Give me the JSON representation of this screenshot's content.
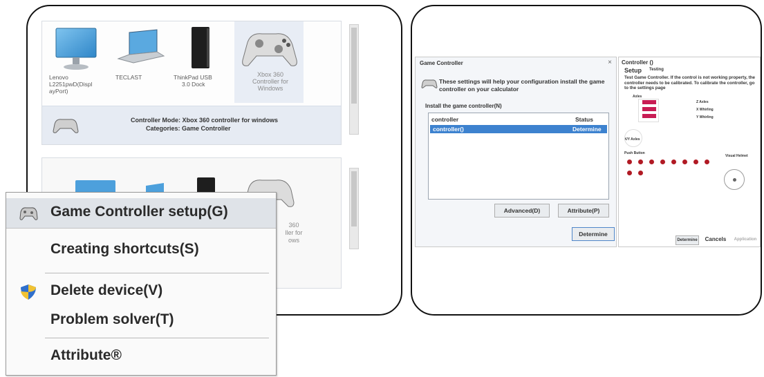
{
  "devices_top": [
    {
      "name": "Lenovo L2251pwD(DisplayPort)",
      "lines": [
        "Lenovo",
        "L2251pwD(Displ",
        "ayPort)"
      ]
    },
    {
      "name": "TECLAST",
      "lines": [
        "TECLAST"
      ]
    },
    {
      "name": "ThinkPad USB 3.0 Dock",
      "lines": [
        "ThinkPad USB",
        "3.0 Dock"
      ]
    },
    {
      "name": "Xbox 360 Controller for Windows",
      "lines": [
        "Xbox 360",
        "Controller for",
        "Windows"
      ]
    }
  ],
  "info_bar": {
    "mode": "Controller Mode: Xbox 360 controller for windows",
    "categories": "Categories: Game Controller"
  },
  "bottom_controller_partial": [
    "360",
    "ller for",
    "ows"
  ],
  "context_menu": {
    "items": [
      {
        "label": "Game Controller setup(G)",
        "icon": "gamepad-icon"
      },
      {
        "label": "Creating shortcuts(S)",
        "icon": ""
      },
      {
        "label": "Delete device(V)",
        "icon": "shield-icon"
      },
      {
        "label": "Problem solver(T)",
        "icon": ""
      },
      {
        "label": "Attribute®",
        "icon": ""
      }
    ]
  },
  "game_dialog": {
    "title": "Game Controller",
    "close": "×",
    "description": "These settings will help your configuration install the game controller on your calculator",
    "install_label": "Install the game controller(N)",
    "list_headers": {
      "name": "controller",
      "status": "Status"
    },
    "rows": [
      {
        "name": "controller()",
        "status": "Determine"
      }
    ],
    "advanced": "Advanced(D)",
    "attribute": "Attribute(P)",
    "determine": "Determine"
  },
  "controller_dialog": {
    "title": "Controller ()",
    "tab_setup": "Setup",
    "tab_testing": "Testing",
    "help": "Test Game Controller. If the control is not working property, the controller needs to be calibrated. To calibrate the controller, go to the settings page",
    "axes_label": "Axles",
    "z_axes": "Z Axles",
    "x_whirling": "X Whirling",
    "y_whirling": "Y Whirling",
    "xy_axes": "X/Y Axles",
    "push_button": "Push Button",
    "visual_helmet": "Visual Helmet",
    "determine": "Determine",
    "cancels": "Cancels",
    "application": "Application"
  },
  "colors": {
    "accent": "#3d82cf",
    "axis_bar": "#c81c54",
    "button_dot": "#b11a24"
  }
}
